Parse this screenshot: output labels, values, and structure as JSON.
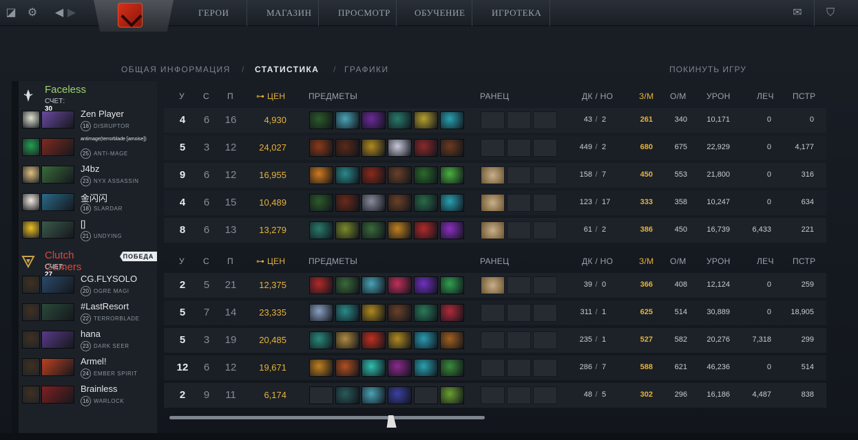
{
  "top_nav": {
    "items": [
      "ГЕРОИ",
      "МАГАЗИН",
      "ПРОСМОТР",
      "ОБУЧЕНИЕ",
      "ИГРОТЕКА"
    ],
    "icons": [
      "dota-menu-icon",
      "settings-gear-icon",
      "back-arrow-icon",
      "forward-arrow-icon",
      "mail-icon",
      "armory-icon"
    ]
  },
  "tabs": {
    "overview": "ОБЩАЯ ИНФОРМАЦИЯ",
    "sep": "/",
    "stats": "СТАТИСТИКА",
    "graphs": "ГРАФИКИ",
    "leave": "ПОКИНУТЬ ИГРУ"
  },
  "headers": {
    "k": "У",
    "d": "С",
    "a": "П",
    "nw": "ЦЕН",
    "items": "ПРЕДМЕТЫ",
    "backpack": "РАНЕЦ",
    "lhdn": "ДК / НО",
    "gpm": "З/М",
    "xpm": "О/М",
    "dmg": "УРОН",
    "heal": "ЛЕЧ",
    "bld": "ПСТР"
  },
  "team1": {
    "name": "Faceless",
    "score_label": "СЧЕТ:",
    "score": "30",
    "name_color": "#9fd36a",
    "players": [
      {
        "name": "Zen Player",
        "level": "18",
        "hero": "DISRUPTOR",
        "k": "4",
        "d": "6",
        "a": "16",
        "nw": "4,930",
        "lh": "43",
        "dn": "2",
        "gpm": "261",
        "xpm": "340",
        "dmg": "10,171",
        "heal": "0",
        "bld": "0"
      },
      {
        "name": "antimage(terrorblade [amoise])",
        "level": "25",
        "hero": "ANTI-MAGE",
        "k": "5",
        "d": "3",
        "a": "12",
        "nw": "24,027",
        "lh": "449",
        "dn": "2",
        "gpm": "680",
        "xpm": "675",
        "dmg": "22,929",
        "heal": "0",
        "bld": "4,177"
      },
      {
        "name": "J4bz",
        "level": "23",
        "hero": "NYX ASSASSIN",
        "k": "9",
        "d": "6",
        "a": "12",
        "nw": "16,955",
        "lh": "158",
        "dn": "7",
        "gpm": "450",
        "xpm": "553",
        "dmg": "21,800",
        "heal": "0",
        "bld": "316"
      },
      {
        "name": "金闪闪",
        "level": "18",
        "hero": "SLARDAR",
        "k": "4",
        "d": "6",
        "a": "15",
        "nw": "10,489",
        "lh": "123",
        "dn": "17",
        "gpm": "333",
        "xpm": "358",
        "dmg": "10,247",
        "heal": "0",
        "bld": "634"
      },
      {
        "name": "[]",
        "level": "21",
        "hero": "UNDYING",
        "k": "8",
        "d": "6",
        "a": "13",
        "nw": "13,279",
        "lh": "61",
        "dn": "2",
        "gpm": "386",
        "xpm": "450",
        "dmg": "16,739",
        "heal": "6,433",
        "bld": "221"
      }
    ]
  },
  "team2": {
    "name": "Clutch Gamers",
    "score_label": "СЧЕТ:",
    "score": "27",
    "name_color": "#e0463a",
    "victory": "ПОБЕДА",
    "players": [
      {
        "name": "CG.FLYSOLO",
        "level": "20",
        "hero": "OGRE MAGI",
        "k": "2",
        "d": "5",
        "a": "21",
        "nw": "12,375",
        "lh": "39",
        "dn": "0",
        "gpm": "366",
        "xpm": "408",
        "dmg": "12,124",
        "heal": "0",
        "bld": "259"
      },
      {
        "name": "#LastResort",
        "level": "22",
        "hero": "TERRORBLADE",
        "k": "5",
        "d": "7",
        "a": "14",
        "nw": "23,335",
        "lh": "311",
        "dn": "1",
        "gpm": "625",
        "xpm": "514",
        "dmg": "30,889",
        "heal": "0",
        "bld": "18,905"
      },
      {
        "name": "hana",
        "level": "23",
        "hero": "DARK SEER",
        "k": "5",
        "d": "3",
        "a": "19",
        "nw": "20,485",
        "lh": "235",
        "dn": "1",
        "gpm": "527",
        "xpm": "582",
        "dmg": "20,276",
        "heal": "7,318",
        "bld": "299"
      },
      {
        "name": "Armel!",
        "level": "24",
        "hero": "EMBER SPIRIT",
        "k": "12",
        "d": "6",
        "a": "12",
        "nw": "19,671",
        "lh": "286",
        "dn": "7",
        "gpm": "588",
        "xpm": "621",
        "dmg": "46,236",
        "heal": "0",
        "bld": "514"
      },
      {
        "name": "Brainless",
        "level": "16",
        "hero": "WARLOCK",
        "k": "2",
        "d": "9",
        "a": "11",
        "nw": "6,174",
        "lh": "48",
        "dn": "5",
        "gpm": "302",
        "xpm": "296",
        "dmg": "16,186",
        "heal": "4,487",
        "bld": "838"
      }
    ]
  }
}
